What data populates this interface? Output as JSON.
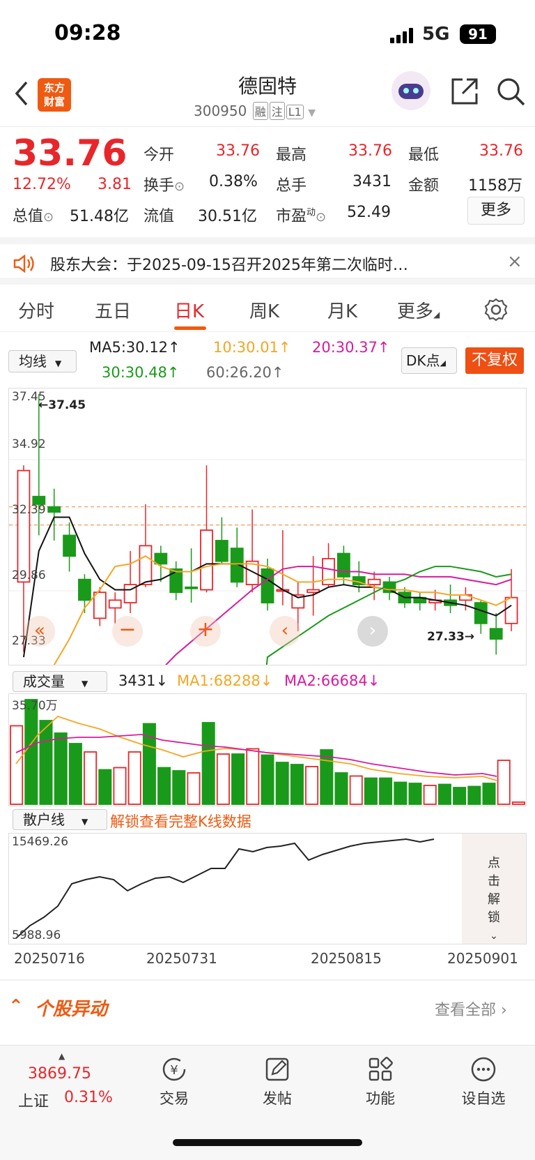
{
  "status": {
    "time": "09:28",
    "network": "5G",
    "battery": "91"
  },
  "header": {
    "logo_line1": "东方",
    "logo_line2": "财富",
    "stock_name": "德固特",
    "stock_code": "300950",
    "tags": [
      "融",
      "注",
      "L1"
    ]
  },
  "quote": {
    "price": "33.76",
    "change_pct": "12.72%",
    "change_amt": "3.81",
    "open_label": "今开",
    "open": "33.76",
    "high_label": "最高",
    "high": "33.76",
    "low_label": "最低",
    "low": "33.76",
    "turnover_label": "换手",
    "turnover": "0.38%",
    "volume_label": "总手",
    "volume": "3431",
    "amount_label": "金额",
    "amount": "1158万",
    "mktcap_label": "总值",
    "mktcap": "51.48亿",
    "float_label": "流值",
    "float": "30.51亿",
    "pe_label": "市盈",
    "pe_sup": "动",
    "pe": "52.49",
    "more": "更多"
  },
  "notice": {
    "text": "股东大会：于2025-09-15召开2025年第二次临时…"
  },
  "tabs": [
    "分时",
    "五日",
    "日K",
    "周K",
    "月K",
    "更多"
  ],
  "ma": {
    "select": "均线",
    "ma5": "MA5:30.12↑",
    "ma10": "10:30.01↑",
    "ma20": "20:30.37↑",
    "ma30": "30:30.48↑",
    "ma60": "60:26.20↑",
    "dk": "DK点",
    "fq": "不复权"
  },
  "kline": {
    "y_ticks": [
      "37.45",
      "34.92",
      "32.39",
      "29.86",
      "27.33"
    ],
    "max_label": "←37.45",
    "min_label": "27.33→"
  },
  "volume": {
    "select": "成交量",
    "vol": "3431↓",
    "ma1": "MA1:68288↓",
    "ma2": "MA2:66684↓",
    "y_top": "35.70万"
  },
  "retail": {
    "select": "散户线",
    "unlock": "解锁查看完整K线数据",
    "y_top": "15469.26",
    "y_bottom": "5988.96",
    "click_unlock": "点击解锁"
  },
  "dates": [
    "20250716",
    "20250731",
    "20250815",
    "20250901"
  ],
  "section": {
    "title": "个股异动",
    "view_all": "查看全部"
  },
  "bottom": {
    "index_value": "3869.75",
    "index_name": "上证",
    "index_pct": "0.31%",
    "nav": [
      "交易",
      "发帖",
      "功能",
      "设自选"
    ]
  },
  "colors": {
    "up": "#e8262a",
    "down": "#1a9a1a",
    "accent": "#ef5a12"
  }
}
